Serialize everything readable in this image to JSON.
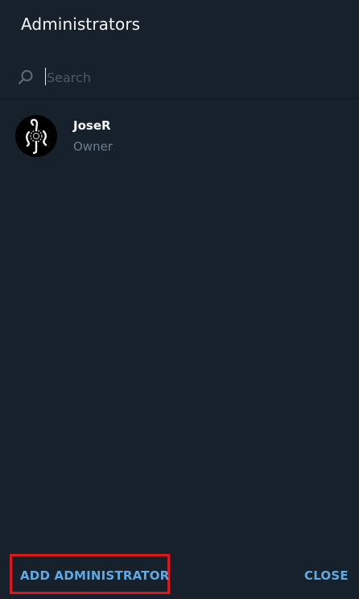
{
  "dialog": {
    "title": "Administrators"
  },
  "search": {
    "placeholder": "Search",
    "value": "",
    "icon": "search-icon"
  },
  "members": [
    {
      "name": "JoseR",
      "role": "Owner",
      "avatar_icon": "avatar"
    }
  ],
  "footer": {
    "add_label": "ADD ADMINISTRATOR",
    "close_label": "CLOSE"
  },
  "colors": {
    "background": "#17212b",
    "accent": "#5eaae4",
    "secondary_text": "#6d7f8f",
    "highlight_border": "#e0161e"
  }
}
